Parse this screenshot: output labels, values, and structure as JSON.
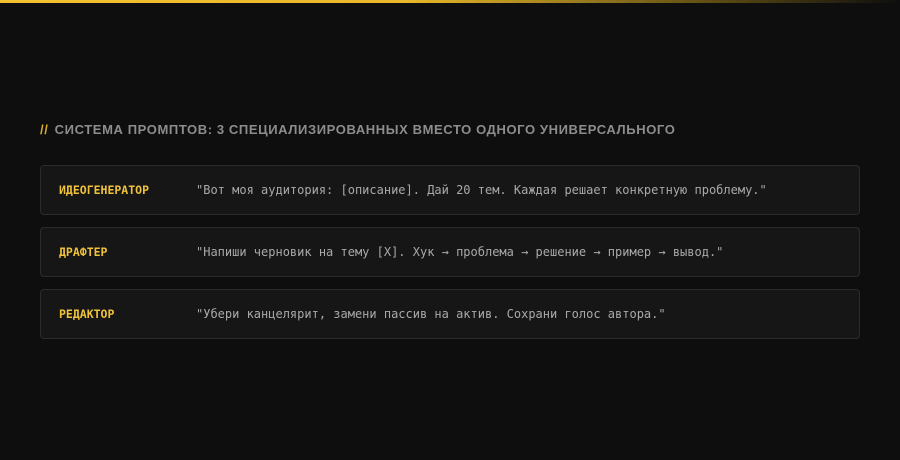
{
  "section": {
    "prefix": "//",
    "title": "СИСТЕМА ПРОМПТОВ: 3 СПЕЦИАЛИЗИРОВАННЫХ ВМЕСТО ОДНОГО УНИВЕРСАЛЬНОГО"
  },
  "prompts": [
    {
      "name": "ИДЕОГЕНЕРАТОР",
      "text": "\"Вот моя аудитория: [описание]. Дай 20 тем. Каждая решает конкретную проблему.\""
    },
    {
      "name": "ДРАФТЕР",
      "text": "\"Напиши черновик на тему [X]. Хук → проблема → решение → пример → вывод.\""
    },
    {
      "name": "РЕДАКТОР",
      "text": "\"Убери канцелярит, замени пассив на актив. Сохрани голос автора.\""
    }
  ],
  "colors": {
    "background": "#0e0e0e",
    "accent": "#f0c23a",
    "card_background": "#161616",
    "card_border": "#2b2b2b",
    "title_text": "#8d8d8d",
    "body_text": "#a9a9a9"
  }
}
